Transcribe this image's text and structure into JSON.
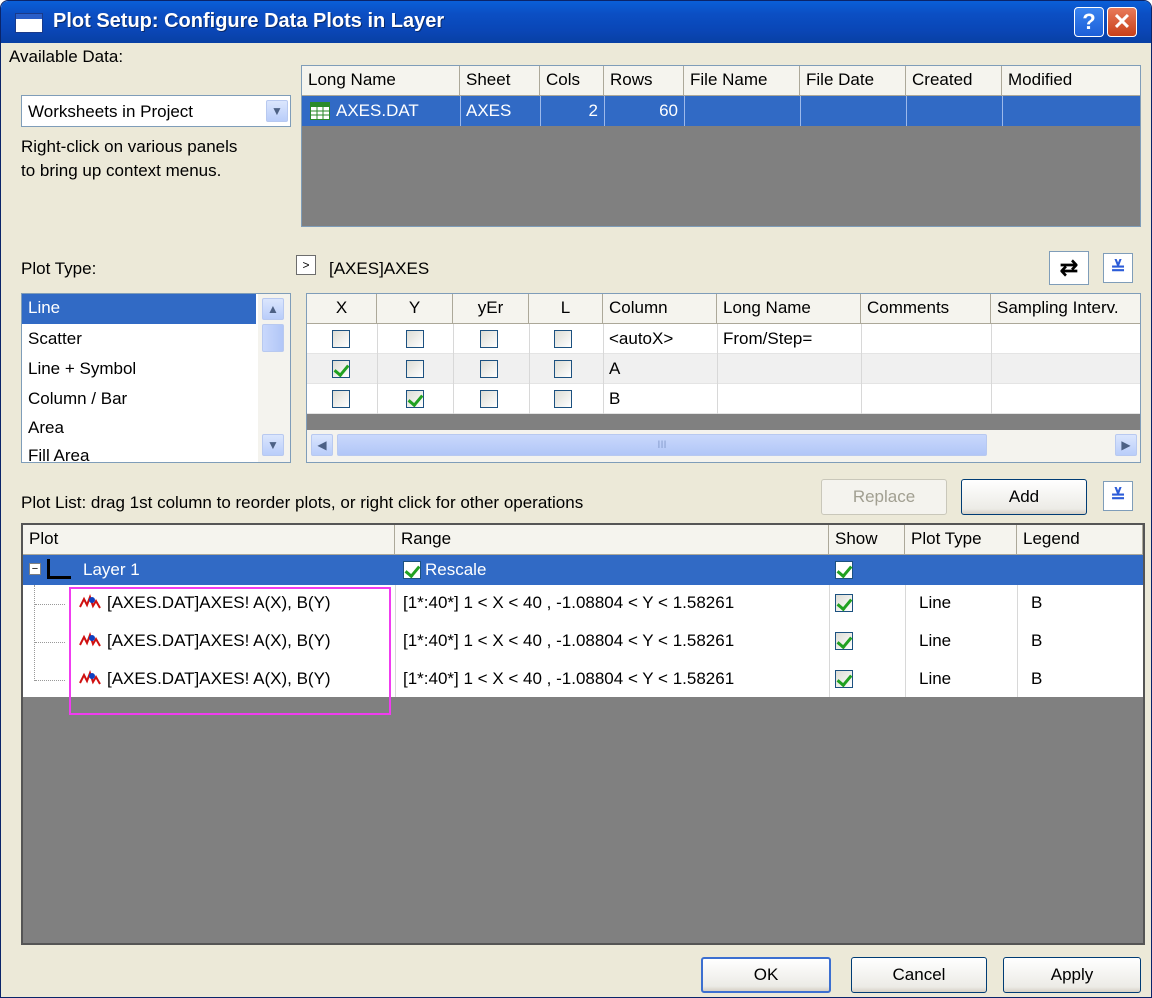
{
  "window": {
    "title": "Plot Setup: Configure Data Plots in Layer",
    "help": "?",
    "close": "✕"
  },
  "available": {
    "label": "Available Data:",
    "select_value": "Worksheets in Project",
    "hint_line1": "Right-click on various panels",
    "hint_line2": "to bring up context menus."
  },
  "data_table": {
    "headers": [
      "Long Name",
      "Sheet",
      "Cols",
      "Rows",
      "File Name",
      "File Date",
      "Created",
      "Modified"
    ],
    "row": {
      "long_name": "AXES.DAT",
      "sheet": "AXES",
      "cols": "2",
      "rows": "60",
      "file_name": "",
      "file_date": "",
      "created": "",
      "modified": ""
    }
  },
  "plot_type": {
    "label": "Plot Type:",
    "items": [
      "Line",
      "Scatter",
      "Line + Symbol",
      "Column / Bar",
      "Area",
      "Fill Area"
    ],
    "selected": "Line"
  },
  "sheet_path": {
    "expander": ">",
    "label": "[AXES]AXES"
  },
  "columns_table": {
    "headers": [
      "X",
      "Y",
      "yEr",
      "L",
      "Column",
      "Long Name",
      "Comments",
      "Sampling Interv."
    ],
    "rows": [
      {
        "column": "<autoX>",
        "long_name": "From/Step=",
        "x": false,
        "y": false,
        "yer": false,
        "l": false
      },
      {
        "column": "A",
        "long_name": "",
        "x": true,
        "y": false,
        "yer": false,
        "l": false
      },
      {
        "column": "B",
        "long_name": "",
        "x": false,
        "y": true,
        "yer": false,
        "l": false
      }
    ],
    "scroll_grip": "III"
  },
  "plot_list": {
    "label": "Plot List: drag 1st column to reorder plots, or right click for other operations",
    "replace": "Replace",
    "add": "Add",
    "headers": [
      "Plot",
      "Range",
      "Show",
      "Plot Type",
      "Legend"
    ],
    "layer": {
      "name": "Layer 1",
      "range": "Rescale",
      "rescale": true,
      "show": true
    },
    "plots": [
      {
        "name": "[AXES.DAT]AXES! A(X), B(Y)",
        "range": "[1*:40*]  1 < X < 40 , -1.08804 < Y < 1.58261",
        "show": true,
        "type": "Line",
        "legend": "B"
      },
      {
        "name": "[AXES.DAT]AXES! A(X), B(Y)",
        "range": "[1*:40*]  1 < X < 40 , -1.08804 < Y < 1.58261",
        "show": true,
        "type": "Line",
        "legend": "B"
      },
      {
        "name": "[AXES.DAT]AXES! A(X), B(Y)",
        "range": "[1*:40*]  1 < X < 40 , -1.08804 < Y < 1.58261",
        "show": true,
        "type": "Line",
        "legend": "B"
      }
    ]
  },
  "buttons": {
    "ok": "OK",
    "cancel": "Cancel",
    "apply": "Apply"
  },
  "colors": {
    "title_blue": "#0a4fc4",
    "selection": "#316ac5",
    "dialog_bg": "#ece9d8",
    "highlight_box": "#f03cf0"
  }
}
